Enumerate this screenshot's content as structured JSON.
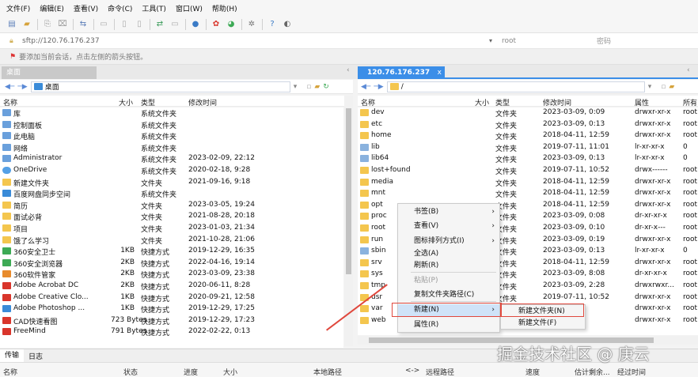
{
  "menu": [
    "文件(F)",
    "编辑(E)",
    "查看(V)",
    "命令(C)",
    "工具(T)",
    "窗口(W)",
    "帮助(H)"
  ],
  "address": {
    "url": "sftp://120.76.176.237",
    "user": "root",
    "password_placeholder": "密码"
  },
  "hint": "要添加当前会话，点击左侧的箭头按钮。",
  "tabs": {
    "left": "桌面",
    "right": "120.76.176.237",
    "right_close": "x"
  },
  "left_panel": {
    "path": "桌面",
    "columns": [
      "名称",
      "大小",
      "类型",
      "修改时间"
    ],
    "rows": [
      {
        "name": "库",
        "size": "",
        "type": "系统文件夹",
        "time": "",
        "icon": "sys"
      },
      {
        "name": "控制面板",
        "size": "",
        "type": "系统文件夹",
        "time": "",
        "icon": "sys"
      },
      {
        "name": "此电脑",
        "size": "",
        "type": "系统文件夹",
        "time": "",
        "icon": "sys"
      },
      {
        "name": "网络",
        "size": "",
        "type": "系统文件夹",
        "time": "",
        "icon": "sys"
      },
      {
        "name": "Administrator",
        "size": "",
        "type": "系统文件夹",
        "time": "2023-02-09, 22:12",
        "icon": "sys"
      },
      {
        "name": "OneDrive",
        "size": "",
        "type": "系统文件夹",
        "time": "2020-02-18, 9:28",
        "icon": "cloud"
      },
      {
        "name": "新建文件夹",
        "size": "",
        "type": "文件夹",
        "time": "2021-09-16, 9:18",
        "icon": "fold"
      },
      {
        "name": "百度网盘同步空间",
        "size": "",
        "type": "系统文件夹",
        "time": "",
        "icon": "app"
      },
      {
        "name": "简历",
        "size": "",
        "type": "文件夹",
        "time": "2023-03-05, 19:24",
        "icon": "fold"
      },
      {
        "name": "面试必背",
        "size": "",
        "type": "文件夹",
        "time": "2021-08-28, 20:18",
        "icon": "fold"
      },
      {
        "name": "项目",
        "size": "",
        "type": "文件夹",
        "time": "2023-01-03, 21:34",
        "icon": "fold"
      },
      {
        "name": "饿了么学习",
        "size": "",
        "type": "文件夹",
        "time": "2021-10-28, 21:06",
        "icon": "fold"
      },
      {
        "name": "360安全卫士",
        "size": "1KB",
        "type": "快捷方式",
        "time": "2019-12-29, 16:35",
        "icon": "green"
      },
      {
        "name": "360安全浏览器",
        "size": "2KB",
        "type": "快捷方式",
        "time": "2022-04-16, 19:14",
        "icon": "green"
      },
      {
        "name": "360软件管家",
        "size": "2KB",
        "type": "快捷方式",
        "time": "2023-03-09, 23:38",
        "icon": "orange"
      },
      {
        "name": "Adobe Acrobat DC",
        "size": "2KB",
        "type": "快捷方式",
        "time": "2020-06-11, 8:28",
        "icon": "red"
      },
      {
        "name": "Adobe Creative Clo...",
        "size": "1KB",
        "type": "快捷方式",
        "time": "2020-09-21, 12:58",
        "icon": "red"
      },
      {
        "name": "Adobe Photoshop ...",
        "size": "1KB",
        "type": "快捷方式",
        "time": "2019-12-29, 17:25",
        "icon": "app"
      },
      {
        "name": "CAD快速看图",
        "size": "723 Bytes",
        "type": "快捷方式",
        "time": "2019-12-29, 17:23",
        "icon": "red"
      },
      {
        "name": "FreeMind",
        "size": "791 Bytes",
        "type": "快捷方式",
        "time": "2022-02-22, 0:13",
        "icon": "red"
      }
    ]
  },
  "right_panel": {
    "path": "/",
    "columns": [
      "名称",
      "大小",
      "类型",
      "修改时间",
      "属性",
      "所有"
    ],
    "rows": [
      {
        "name": "dev",
        "type": "文件夹",
        "time": "2023-03-09, 0:09",
        "attr": "drwxr-xr-x",
        "owner": "root",
        "icon": "fold"
      },
      {
        "name": "etc",
        "type": "文件夹",
        "time": "2023-03-09, 0:13",
        "attr": "drwxr-xr-x",
        "owner": "root",
        "icon": "fold"
      },
      {
        "name": "home",
        "type": "文件夹",
        "time": "2018-04-11, 12:59",
        "attr": "drwxr-xr-x",
        "owner": "root",
        "icon": "fold"
      },
      {
        "name": "lib",
        "type": "文件夹",
        "time": "2019-07-11, 11:01",
        "attr": "lr-xr-xr-x",
        "owner": "0",
        "icon": "link"
      },
      {
        "name": "lib64",
        "type": "文件夹",
        "time": "2023-03-09, 0:13",
        "attr": "lr-xr-xr-x",
        "owner": "0",
        "icon": "link"
      },
      {
        "name": "lost+found",
        "type": "文件夹",
        "time": "2019-07-11, 10:52",
        "attr": "drwx------",
        "owner": "root",
        "icon": "fold"
      },
      {
        "name": "media",
        "type": "文件夹",
        "time": "2018-04-11, 12:59",
        "attr": "drwxr-xr-x",
        "owner": "root",
        "icon": "fold"
      },
      {
        "name": "mnt",
        "type": "文件夹",
        "time": "2018-04-11, 12:59",
        "attr": "drwxr-xr-x",
        "owner": "root",
        "icon": "fold"
      },
      {
        "name": "opt",
        "type": "文件夹",
        "time": "2018-04-11, 12:59",
        "attr": "drwxr-xr-x",
        "owner": "root",
        "icon": "fold"
      },
      {
        "name": "proc",
        "type": "文件夹",
        "time": "2023-03-09, 0:08",
        "attr": "dr-xr-xr-x",
        "owner": "root",
        "icon": "fold"
      },
      {
        "name": "root",
        "type": "文件夹",
        "time": "2023-03-09, 0:10",
        "attr": "dr-xr-x---",
        "owner": "root",
        "icon": "fold"
      },
      {
        "name": "run",
        "type": "文件夹",
        "time": "2023-03-09, 0:19",
        "attr": "drwxr-xr-x",
        "owner": "root",
        "icon": "fold"
      },
      {
        "name": "sbin",
        "type": "文件夹",
        "time": "2023-03-09, 0:13",
        "attr": "lr-xr-xr-x",
        "owner": "0",
        "icon": "link"
      },
      {
        "name": "srv",
        "type": "文件夹",
        "time": "2018-04-11, 12:59",
        "attr": "drwxr-xr-x",
        "owner": "root",
        "icon": "fold"
      },
      {
        "name": "sys",
        "type": "文件夹",
        "time": "2023-03-09, 8:08",
        "attr": "dr-xr-xr-x",
        "owner": "root",
        "icon": "fold"
      },
      {
        "name": "tmp",
        "type": "文件夹",
        "time": "2023-03-09, 2:28",
        "attr": "drwxrwxr...",
        "owner": "root",
        "icon": "fold"
      },
      {
        "name": "usr",
        "type": "文件夹",
        "time": "2019-07-11, 10:52",
        "attr": "drwxr-xr-x",
        "owner": "root",
        "icon": "fold"
      },
      {
        "name": "var",
        "type": "文件夹",
        "time": "55",
        "attr": "drwxr-xr-x",
        "owner": "root",
        "icon": "fold"
      },
      {
        "name": "web",
        "type": "文件夹",
        "time": "59",
        "attr": "drwxr-xr-x",
        "owner": "root",
        "icon": "fold"
      }
    ]
  },
  "context_menu": {
    "items": [
      {
        "label": "书签(B)",
        "sub": "›",
        "state": ""
      },
      {
        "label": "查看(V)",
        "sub": "›",
        "state": ""
      },
      {
        "label": "图标排列方式(I)",
        "sub": "›",
        "state": ""
      },
      {
        "label": "全选(A)",
        "sub": "",
        "state": ""
      },
      {
        "label": "刷新(R)",
        "sub": "",
        "state": ""
      },
      {
        "label": "粘贴(P)",
        "sub": "",
        "state": "dis"
      },
      {
        "label": "复制文件夹路径(C)",
        "sub": "",
        "state": ""
      },
      {
        "label": "新建(N)",
        "sub": "›",
        "state": "hl"
      },
      {
        "label": "属性(R)",
        "sub": "",
        "state": ""
      }
    ],
    "submenu": [
      "新建文件夹(N)",
      "新建文件(F)"
    ]
  },
  "log_tabs": [
    "传输",
    "日志"
  ],
  "status_columns": [
    "名称",
    "状态",
    "进度",
    "大小",
    "本地路径",
    "<->",
    "远程路径",
    "速度",
    "估计剩余...",
    "经过时间"
  ],
  "watermark": "掘金技术社区 @ 庚云",
  "colors": {
    "accent": "#3b8ee8",
    "highlight_box": "#e0483d",
    "menu_highlight": "#cfe3f8"
  }
}
